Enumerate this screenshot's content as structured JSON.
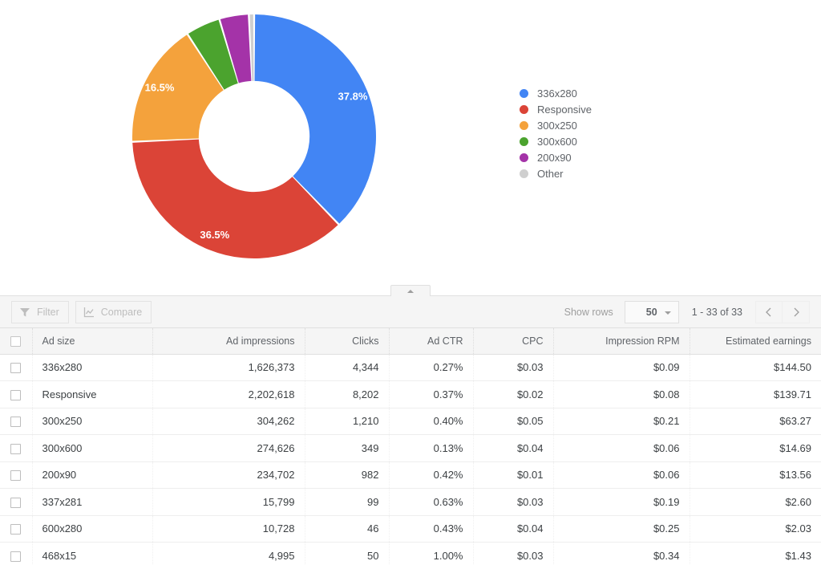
{
  "chart_data": {
    "type": "pie",
    "variant": "donut",
    "title": "",
    "categories": [
      "336x280",
      "Responsive",
      "300x250",
      "300x600",
      "200x90",
      "Other"
    ],
    "values": [
      37.8,
      36.5,
      16.5,
      4.6,
      3.9,
      0.7
    ],
    "unit": "%",
    "value_labels": [
      "37.8%",
      "36.5%",
      "16.5%",
      "",
      "",
      ""
    ],
    "colors": [
      "#4285f4",
      "#db4437",
      "#f4a23c",
      "#4ba32e",
      "#a433a8",
      "#cfcfcf"
    ],
    "legend_position": "right",
    "grid": false,
    "start_angle": 0,
    "direction": "clockwise",
    "inner_radius_ratio": 0.455
  },
  "legend": {
    "items": [
      {
        "label": "336x280",
        "color": "#4285f4"
      },
      {
        "label": "Responsive",
        "color": "#db4437"
      },
      {
        "label": "300x250",
        "color": "#f4a23c"
      },
      {
        "label": "300x600",
        "color": "#4ba32e"
      },
      {
        "label": "200x90",
        "color": "#a433a8"
      },
      {
        "label": "Other",
        "color": "#cfcfcf"
      }
    ]
  },
  "toolbar": {
    "filter_label": "Filter",
    "compare_label": "Compare",
    "show_rows_label": "Show rows",
    "rows_value": "50",
    "range_text": "1 - 33 of 33"
  },
  "table": {
    "columns": [
      {
        "key": "checkbox",
        "label": "",
        "align": "center"
      },
      {
        "key": "ad_size",
        "label": "Ad size",
        "align": "left"
      },
      {
        "key": "impr",
        "label": "Ad impressions",
        "align": "right"
      },
      {
        "key": "clicks",
        "label": "Clicks",
        "align": "right"
      },
      {
        "key": "ctr",
        "label": "Ad CTR",
        "align": "right"
      },
      {
        "key": "cpc",
        "label": "CPC",
        "align": "right"
      },
      {
        "key": "rpm",
        "label": "Impression RPM",
        "align": "right"
      },
      {
        "key": "earnings",
        "label": "Estimated earnings",
        "align": "right"
      }
    ],
    "rows": [
      {
        "ad_size": "336x280",
        "impr": "1,626,373",
        "clicks": "4,344",
        "ctr": "0.27%",
        "cpc": "$0.03",
        "rpm": "$0.09",
        "earnings": "$144.50"
      },
      {
        "ad_size": "Responsive",
        "impr": "2,202,618",
        "clicks": "8,202",
        "ctr": "0.37%",
        "cpc": "$0.02",
        "rpm": "$0.08",
        "earnings": "$139.71"
      },
      {
        "ad_size": "300x250",
        "impr": "304,262",
        "clicks": "1,210",
        "ctr": "0.40%",
        "cpc": "$0.05",
        "rpm": "$0.21",
        "earnings": "$63.27"
      },
      {
        "ad_size": "300x600",
        "impr": "274,626",
        "clicks": "349",
        "ctr": "0.13%",
        "cpc": "$0.04",
        "rpm": "$0.06",
        "earnings": "$14.69"
      },
      {
        "ad_size": "200x90",
        "impr": "234,702",
        "clicks": "982",
        "ctr": "0.42%",
        "cpc": "$0.01",
        "rpm": "$0.06",
        "earnings": "$13.56"
      },
      {
        "ad_size": "337x281",
        "impr": "15,799",
        "clicks": "99",
        "ctr": "0.63%",
        "cpc": "$0.03",
        "rpm": "$0.19",
        "earnings": "$2.60"
      },
      {
        "ad_size": "600x280",
        "impr": "10,728",
        "clicks": "46",
        "ctr": "0.43%",
        "cpc": "$0.04",
        "rpm": "$0.25",
        "earnings": "$2.03"
      },
      {
        "ad_size": "468x15",
        "impr": "4,995",
        "clicks": "50",
        "ctr": "1.00%",
        "cpc": "$0.03",
        "rpm": "$0.34",
        "earnings": "$1.43"
      }
    ]
  }
}
